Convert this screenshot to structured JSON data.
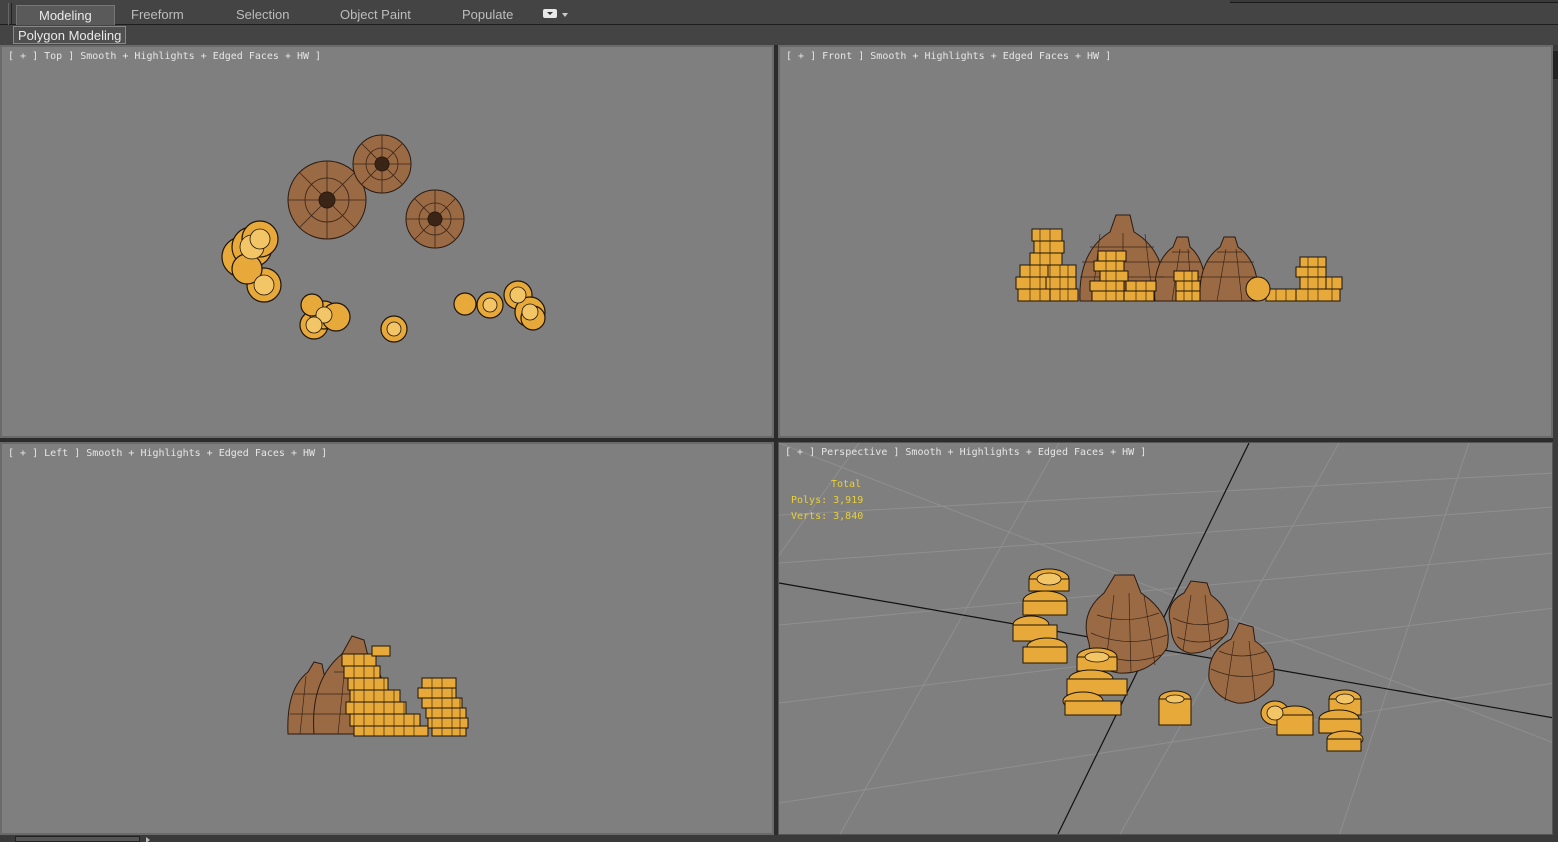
{
  "ribbon": {
    "tabs": [
      {
        "label": "Modeling",
        "active": true
      },
      {
        "label": "Freeform"
      },
      {
        "label": "Selection"
      },
      {
        "label": "Object Paint"
      },
      {
        "label": "Populate"
      }
    ],
    "panel_label": "Polygon Modeling"
  },
  "viewports": {
    "top": {
      "label": "[ + ] Top ] Smooth + Highlights + Edged Faces + HW ]"
    },
    "front": {
      "label": "[ + ] Front ] Smooth + Highlights + Edged Faces + HW ]"
    },
    "left": {
      "label": "[ + ] Left ] Smooth + Highlights + Edged Faces + HW ]"
    },
    "persp": {
      "label": "[ + ] Perspective ] Smooth + Highlights + Edged Faces + HW ]"
    }
  },
  "stats": {
    "title": "Total",
    "polys": "Polys: 3,919",
    "verts": "Verts: 3,840"
  },
  "colors": {
    "viewport_bg": "#7f7f7f",
    "coin": "#e6a93a",
    "bag": "#9a6a45",
    "stats_text": "#e8d13a"
  }
}
